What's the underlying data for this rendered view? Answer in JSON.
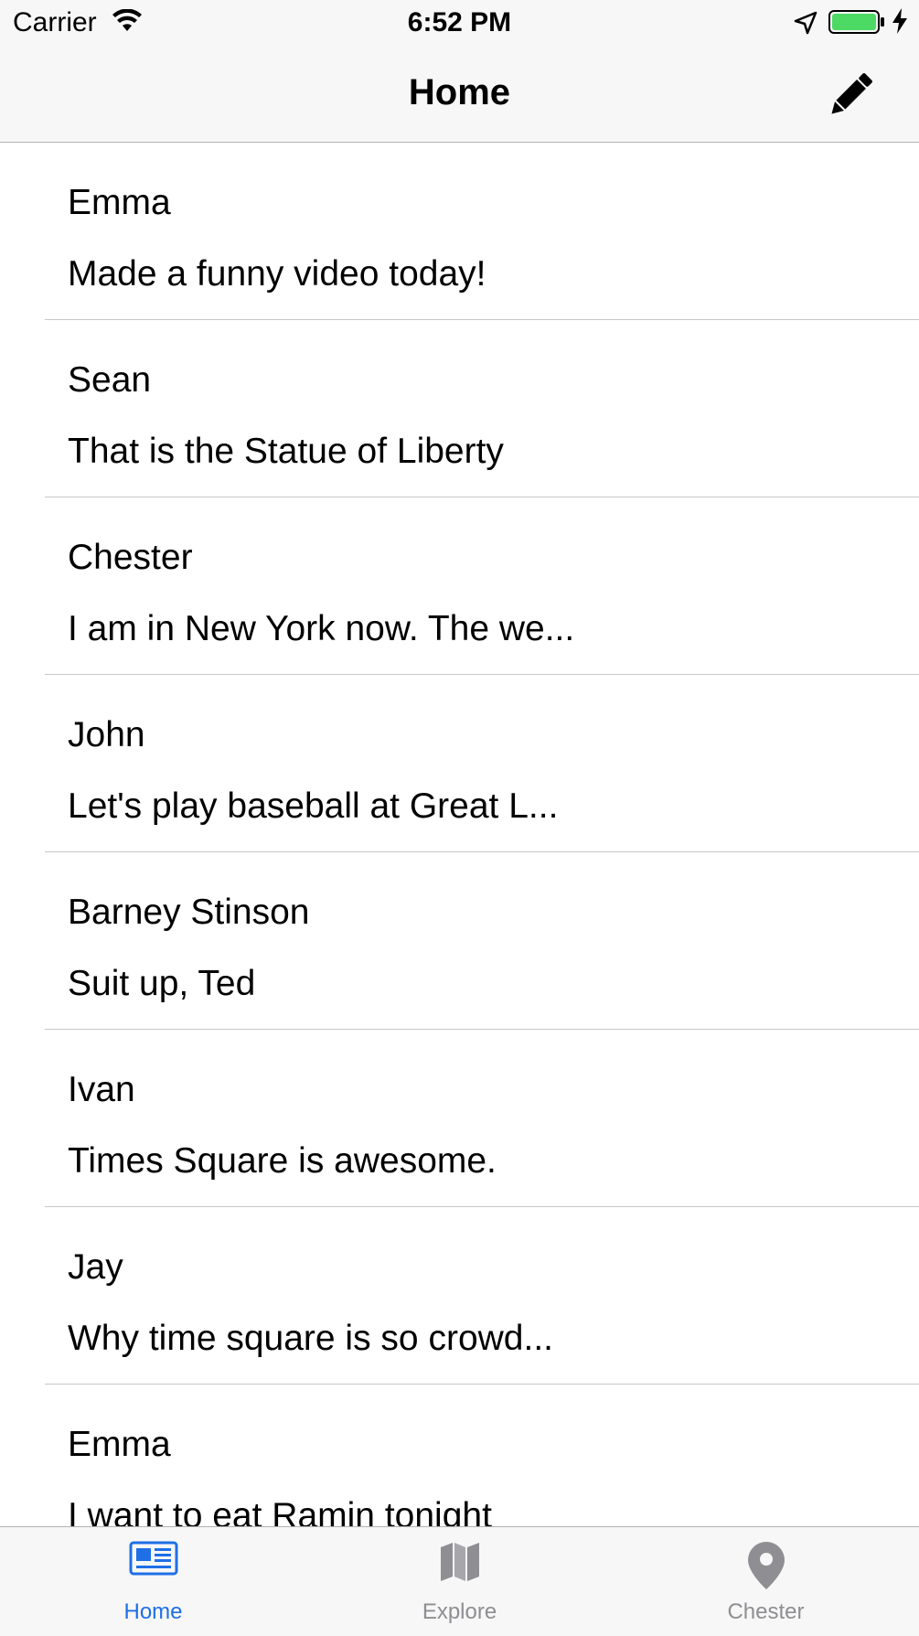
{
  "status_bar": {
    "carrier": "Carrier",
    "time": "6:52 PM",
    "icons": [
      "wifi-icon",
      "location-arrow-icon",
      "battery-icon",
      "charging-bolt-icon"
    ],
    "battery_color": "#4cd964"
  },
  "nav": {
    "title": "Home",
    "compose_icon": "pencil-icon"
  },
  "posts": [
    {
      "name": "Emma",
      "message": "Made a funny video today!"
    },
    {
      "name": "Sean",
      "message": "That is the Statue of Liberty"
    },
    {
      "name": "Chester",
      "message": "I am in New York now. The we..."
    },
    {
      "name": "John",
      "message": "Let's play baseball at Great L..."
    },
    {
      "name": "Barney Stinson",
      "message": "Suit up, Ted"
    },
    {
      "name": "Ivan",
      "message": "Times Square is awesome."
    },
    {
      "name": "Jay",
      "message": "Why time square is so crowd..."
    },
    {
      "name": "Emma",
      "message": "I want to eat Ramin tonight"
    }
  ],
  "tabs": [
    {
      "label": "Home",
      "icon": "newspaper-icon",
      "active": true
    },
    {
      "label": "Explore",
      "icon": "map-icon",
      "active": false
    },
    {
      "label": "Chester",
      "icon": "location-pin-icon",
      "active": false
    }
  ],
  "colors": {
    "accent": "#1f6fe6",
    "inactive": "#8e8e93",
    "bar_background": "#f7f7f7"
  }
}
